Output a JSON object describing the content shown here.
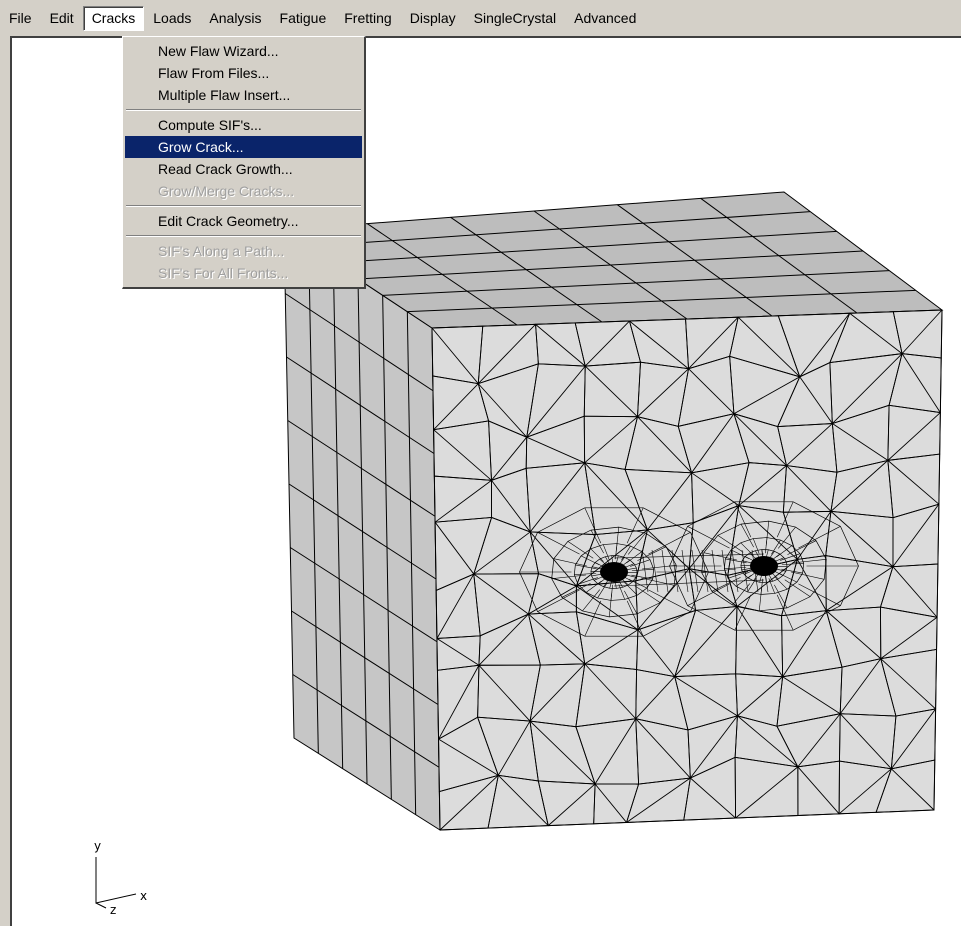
{
  "menubar": {
    "items": [
      {
        "id": "file",
        "label": "File"
      },
      {
        "id": "edit",
        "label": "Edit"
      },
      {
        "id": "cracks",
        "label": "Cracks",
        "open": true
      },
      {
        "id": "loads",
        "label": "Loads"
      },
      {
        "id": "analysis",
        "label": "Analysis"
      },
      {
        "id": "fatigue",
        "label": "Fatigue"
      },
      {
        "id": "fretting",
        "label": "Fretting"
      },
      {
        "id": "display",
        "label": "Display"
      },
      {
        "id": "singlecrystal",
        "label": "SingleCrystal"
      },
      {
        "id": "advanced",
        "label": "Advanced"
      }
    ]
  },
  "cracks_menu": {
    "group1": [
      {
        "label": "New Flaw Wizard...",
        "enabled": true
      },
      {
        "label": "Flaw From Files...",
        "enabled": true
      },
      {
        "label": "Multiple Flaw Insert...",
        "enabled": true
      }
    ],
    "group2": [
      {
        "label": "Compute SIF's...",
        "enabled": true
      },
      {
        "label": "Grow Crack...",
        "enabled": true,
        "selected": true
      },
      {
        "label": "Read Crack Growth...",
        "enabled": true
      },
      {
        "label": "Grow/Merge Cracks...",
        "enabled": false
      }
    ],
    "group3": [
      {
        "label": "Edit Crack Geometry...",
        "enabled": true
      }
    ],
    "group4": [
      {
        "label": "SIF's Along a Path...",
        "enabled": false
      },
      {
        "label": "SIF's For All Fronts...",
        "enabled": false
      }
    ]
  },
  "axis_triad": {
    "x": "x",
    "y": "y",
    "z": "z"
  },
  "colors": {
    "menu_background": "#d4d0c8",
    "highlight": "#0a246a",
    "viewport_background": "#ffffff",
    "mesh_face": "#dcdcdc",
    "mesh_top": "#bdbdbd",
    "mesh_side": "#c6c6c6"
  }
}
